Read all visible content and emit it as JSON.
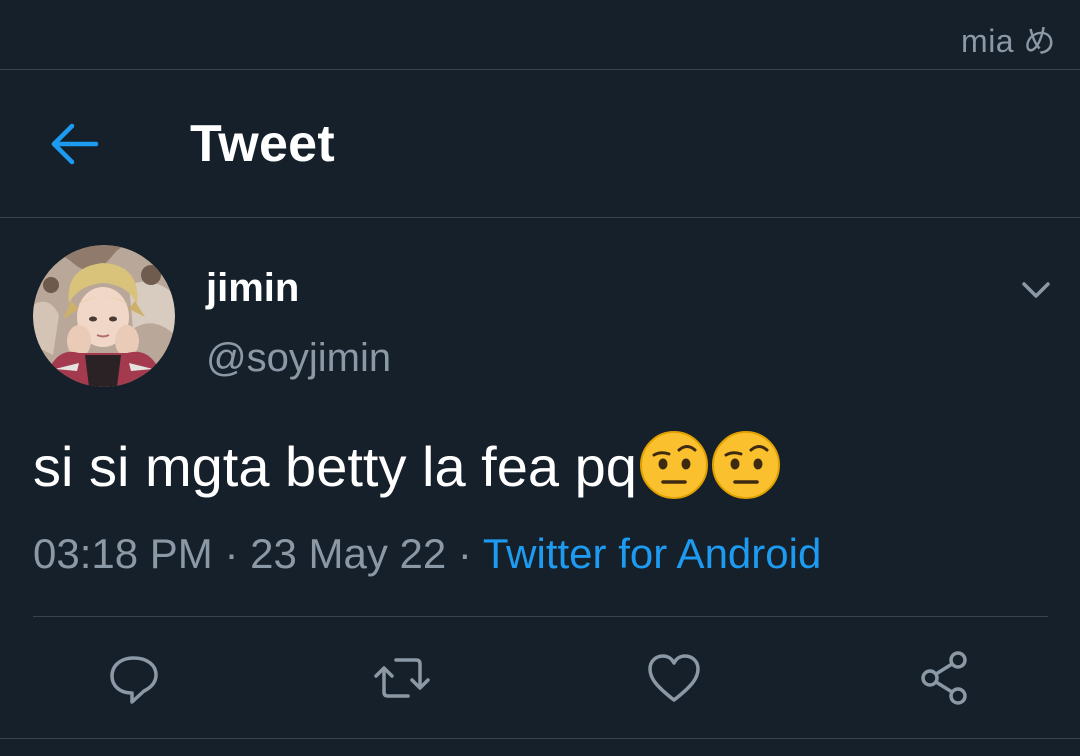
{
  "statusbar": {
    "watermark": "mia め"
  },
  "header": {
    "title": "Tweet",
    "back_icon": "arrow-left-icon",
    "accent_color": "#1d9bf0"
  },
  "tweet": {
    "author": {
      "display_name": "jimin",
      "handle": "@soyjimin"
    },
    "text": "si si mgta betty la fea pq",
    "emojis": [
      "face-with-raised-eyebrow-emoji",
      "face-with-raised-eyebrow-emoji"
    ],
    "time": "03:18 PM",
    "separator": "·",
    "date": "23 May 22",
    "source": "Twitter for Android",
    "menu_icon": "chevron-down-icon"
  },
  "actions": [
    {
      "name": "reply",
      "icon": "reply-icon"
    },
    {
      "name": "retweet",
      "icon": "retweet-icon"
    },
    {
      "name": "like",
      "icon": "heart-icon"
    },
    {
      "name": "share",
      "icon": "share-icon"
    }
  ],
  "colors": {
    "background": "#15202b",
    "divider": "#38444d",
    "secondary_text": "#8b98a5",
    "link": "#1d9bf0"
  }
}
